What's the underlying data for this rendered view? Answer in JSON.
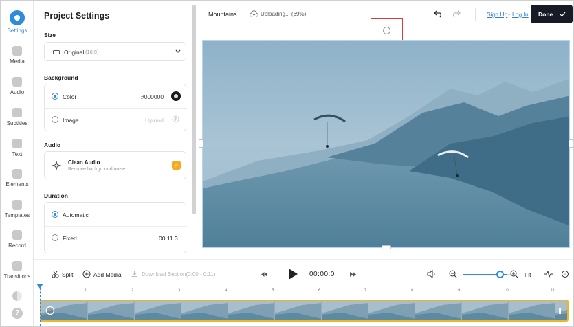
{
  "rail": {
    "items": [
      {
        "label": "Settings",
        "icon": "settings-icon",
        "active": true
      },
      {
        "label": "Media",
        "icon": "plus-icon"
      },
      {
        "label": "Audio",
        "icon": "music-note-icon"
      },
      {
        "label": "Subtitles",
        "icon": "subtitles-icon"
      },
      {
        "label": "Text",
        "icon": "text-icon"
      },
      {
        "label": "Elements",
        "icon": "elements-icon"
      },
      {
        "label": "Templates",
        "icon": "templates-icon"
      },
      {
        "label": "Record",
        "icon": "record-icon"
      },
      {
        "label": "Transitions",
        "icon": "transitions-icon"
      }
    ],
    "help_label": "?"
  },
  "panel": {
    "title": "Project Settings",
    "size": {
      "heading": "Size",
      "value": "Original",
      "ratio": "(16:9)"
    },
    "background": {
      "heading": "Background",
      "color_label": "Color",
      "color_value": "#000000",
      "image_label": "Image",
      "upload_label": "Upload"
    },
    "audio": {
      "heading": "Audio",
      "clean_title": "Clean Audio",
      "clean_sub": "Remove background noise"
    },
    "duration": {
      "heading": "Duration",
      "automatic_label": "Automatic",
      "fixed_label": "Fixed",
      "fixed_value": "00:11.3"
    }
  },
  "topbar": {
    "project_name": "Mountains",
    "upload_status": "Uploading... (69%)",
    "upload_progress": 0.69,
    "sign_up": "Sign Up",
    "separator": "-",
    "log_in": "Log In",
    "done_label": "Done"
  },
  "controls": {
    "split_label": "Split",
    "add_media_label": "Add Media",
    "download_label": "Download Section(0:00 - 0:11)",
    "time": "00:00:0",
    "fit_label": "Fit",
    "zoom_level": 0.7
  },
  "ruler": {
    "ticks": [
      "1",
      "2",
      "3",
      "4",
      "5",
      "6",
      "7",
      "8",
      "9",
      "10",
      "11"
    ]
  },
  "colors": {
    "accent": "#2f8bde",
    "track_border": "#f0b429",
    "done_bg": "#161b26",
    "highlight": "#e53935"
  }
}
